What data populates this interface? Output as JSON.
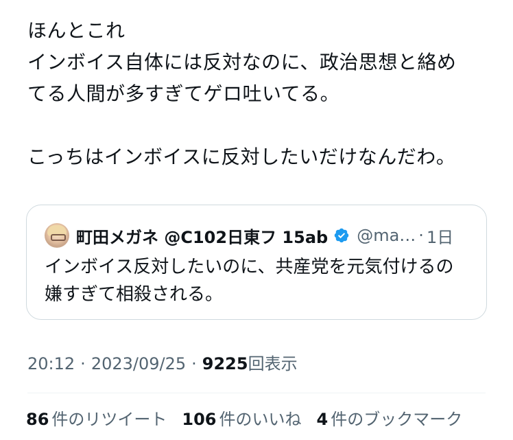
{
  "tweet": {
    "text_lines": [
      "ほんとこれ",
      "インボイス自体には反対なのに、政治思想と絡め",
      "てる人間が多すぎてゲロ吐いてる。",
      "",
      "こっちはインボイスに反対したいだけなんだわ。"
    ]
  },
  "quote": {
    "name": "町田メガネ @C102日東フ 15ab",
    "handle": "@ma…",
    "dot": "·",
    "time": "1日",
    "text_lines": [
      "インボイス反対したいのに、共産党を元気付けるの",
      "嫌すぎて相殺される。"
    ],
    "verified_icon": "verified-badge-icon",
    "verified_color": "#1d9bf0"
  },
  "meta": {
    "time": "20:12",
    "sep1": "·",
    "date": "2023/09/25",
    "sep2": "·",
    "views_count": "9225",
    "views_label": "回表示"
  },
  "stats": {
    "retweets_count": "86",
    "retweets_label": "件のリツイート",
    "likes_count": "106",
    "likes_label": "件のいいね",
    "bookmarks_count": "4",
    "bookmarks_label": "件のブックマーク"
  },
  "colors": {
    "text": "#0f1419",
    "secondary": "#536471",
    "border": "#cfd9de"
  }
}
